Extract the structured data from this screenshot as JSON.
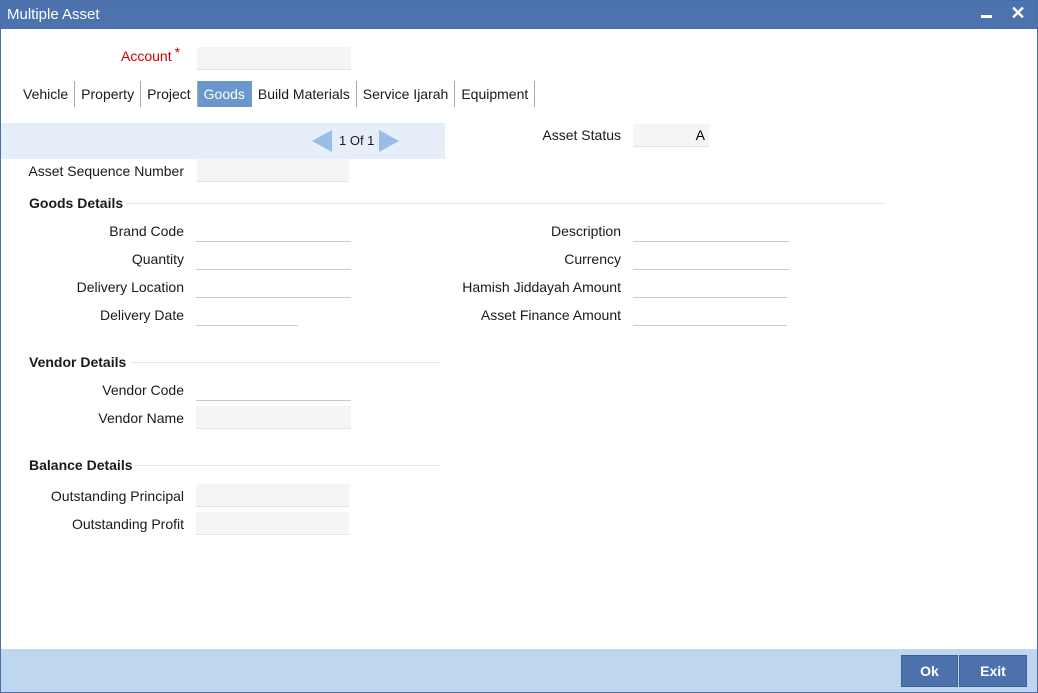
{
  "window": {
    "title": "Multiple Asset"
  },
  "header": {
    "account_label": "Account",
    "account_required": "*",
    "account_value": ""
  },
  "tabs": [
    {
      "label": "Vehicle"
    },
    {
      "label": "Property"
    },
    {
      "label": "Project"
    },
    {
      "label": "Goods",
      "active": true
    },
    {
      "label": "Build Materials"
    },
    {
      "label": "Service Ijarah"
    },
    {
      "label": "Equipment"
    }
  ],
  "pager": {
    "text": "1 Of 1"
  },
  "asset": {
    "status_label": "Asset Status",
    "status_value": "A",
    "sequence_label": "Asset Sequence Number",
    "sequence_value": ""
  },
  "goods": {
    "title": "Goods Details",
    "brand_code_label": "Brand Code",
    "quantity_label": "Quantity",
    "delivery_location_label": "Delivery Location",
    "delivery_date_label": "Delivery Date",
    "description_label": "Description",
    "currency_label": "Currency",
    "hamish_label": "Hamish Jiddayah Amount",
    "finance_label": "Asset Finance Amount",
    "brand_code_value": "",
    "quantity_value": "",
    "delivery_location_value": "",
    "delivery_date_value": "",
    "description_value": "",
    "currency_value": "",
    "hamish_value": "",
    "finance_value": ""
  },
  "vendor": {
    "title": "Vendor Details",
    "code_label": "Vendor Code",
    "name_label": "Vendor Name",
    "code_value": "",
    "name_value": ""
  },
  "balance": {
    "title": "Balance Details",
    "principal_label": "Outstanding Principal",
    "profit_label": "Outstanding Profit",
    "principal_value": "",
    "profit_value": ""
  },
  "footer": {
    "ok_label": "Ok",
    "exit_label": "Exit"
  },
  "colors": {
    "titlebar": "#4c73ad",
    "active_tab": "#6a97cc",
    "footer": "#bed7ef",
    "button": "#4d72ab",
    "required": "#cc0000"
  }
}
